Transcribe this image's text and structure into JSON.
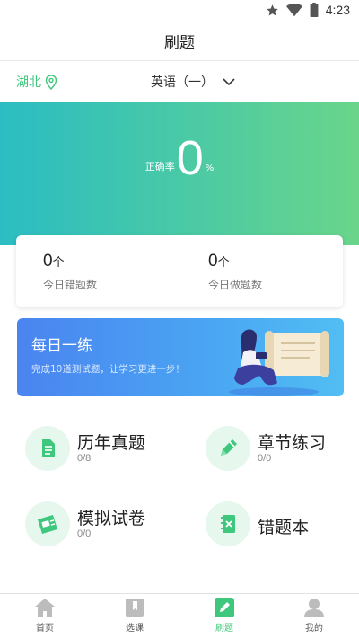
{
  "status_bar": {
    "time": "4:23",
    "icons": [
      "star-icon",
      "wifi-icon",
      "battery-icon"
    ]
  },
  "header": {
    "title": "刷题"
  },
  "selector": {
    "region": "湖北",
    "subject": "英语（一）"
  },
  "hero": {
    "rate_label": "正确率",
    "rate_value": "0",
    "rate_unit": "%"
  },
  "stats": [
    {
      "value": "0",
      "unit": "个",
      "label": "今日错题数"
    },
    {
      "value": "0",
      "unit": "个",
      "label": "今日做题数"
    }
  ],
  "daily": {
    "title": "每日一练",
    "subtitle": "完成10道测试题，让学习更进一步！"
  },
  "features": [
    {
      "title": "历年真题",
      "count": "0/8",
      "icon": "document-icon"
    },
    {
      "title": "章节练习",
      "count": "0/0",
      "icon": "pencil-icon"
    },
    {
      "title": "模拟试卷",
      "count": "0/0",
      "icon": "paper-icon"
    },
    {
      "title": "错题本",
      "count": "",
      "icon": "error-book-icon"
    }
  ],
  "nav": [
    {
      "label": "首页",
      "icon": "home-icon",
      "active": false
    },
    {
      "label": "选课",
      "icon": "course-icon",
      "active": false
    },
    {
      "label": "刷题",
      "icon": "practice-icon",
      "active": true
    },
    {
      "label": "我的",
      "icon": "profile-icon",
      "active": false
    }
  ],
  "colors": {
    "accent": "#3fc77d",
    "hero_start": "#2bbdc3",
    "hero_end": "#6ad58a",
    "banner": "#4a90f0",
    "icon_bg": "#e6f8ee",
    "nav_inactive": "#bcbcbc"
  }
}
